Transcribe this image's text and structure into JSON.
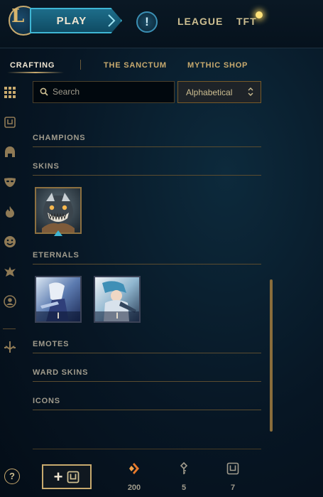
{
  "topbar": {
    "logo_letter": "L",
    "play_label": "PLAY",
    "alert_label": "!",
    "nav": [
      "LEAGUE",
      "TFT"
    ]
  },
  "tabs": [
    "CRAFTING",
    "THE SANCTUM",
    "MYTHIC SHOP"
  ],
  "search": {
    "placeholder": "Search",
    "value": ""
  },
  "sort": {
    "selected": "Alphabetical"
  },
  "sections": {
    "champions": "CHAMPIONS",
    "skins": "SKINS",
    "eternals": "ETERNALS",
    "emotes": "EMOTES",
    "ward_skins": "WARD SKINS",
    "icons": "ICONS"
  },
  "eternal_tiles": [
    {
      "label": "I"
    },
    {
      "label": "I"
    }
  ],
  "footer": {
    "help_label": "?",
    "add_label": "+",
    "currencies": [
      {
        "icon": "orange-essence-icon",
        "value": "200"
      },
      {
        "icon": "key-fragment-icon",
        "value": "5"
      },
      {
        "icon": "chest-icon",
        "value": "7"
      }
    ]
  },
  "colors": {
    "gold": "#c8aa6e",
    "accent_blue": "#3fb6d4",
    "background": "#071624"
  }
}
